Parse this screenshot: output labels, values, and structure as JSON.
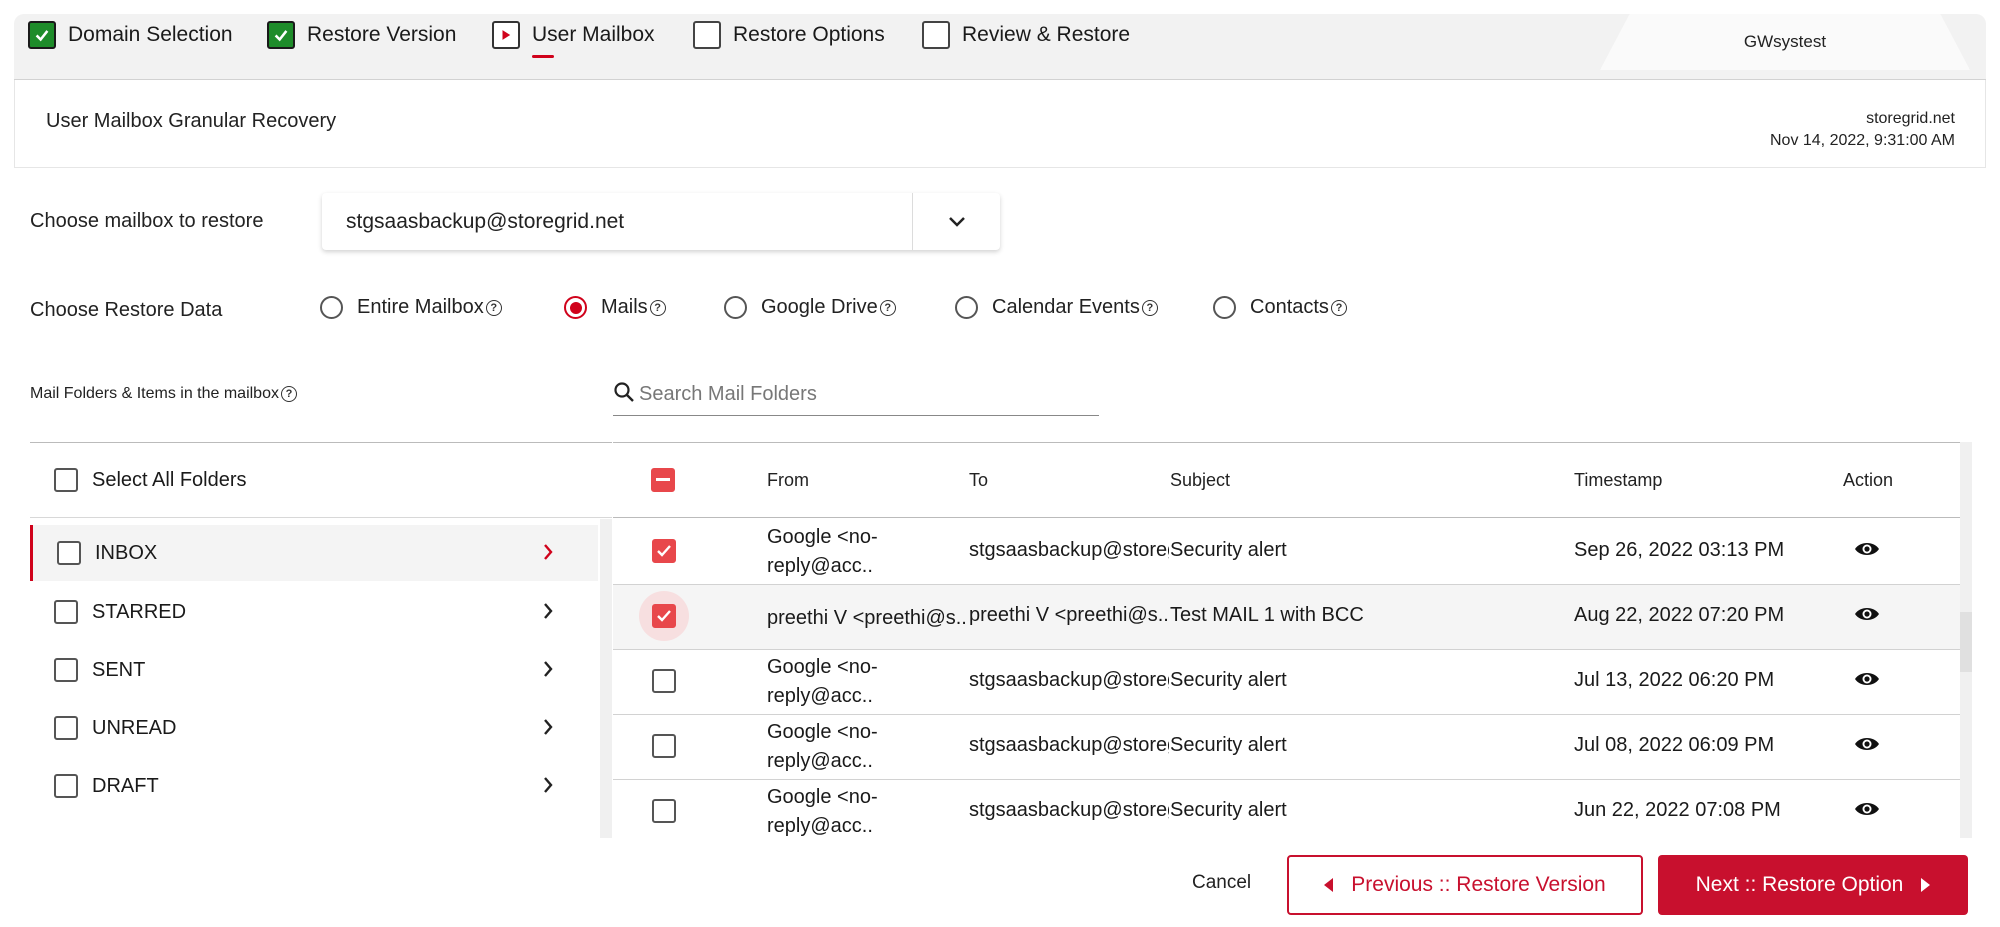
{
  "steps": [
    {
      "label": "Domain Selection",
      "state": "done"
    },
    {
      "label": "Restore Version",
      "state": "done"
    },
    {
      "label": "User Mailbox",
      "state": "current"
    },
    {
      "label": "Restore Options",
      "state": "pending"
    },
    {
      "label": "Review & Restore",
      "state": "pending"
    }
  ],
  "user_tab": "GWsystest",
  "header": {
    "title": "User Mailbox Granular Recovery",
    "domain": "storegrid.net",
    "version_time": "Nov 14, 2022, 9:31:00 AM"
  },
  "mailbox": {
    "label": "Choose mailbox to restore",
    "selected": "stgsaasbackup@storegrid.net"
  },
  "restore_data": {
    "label": "Choose Restore Data",
    "options": [
      "Entire Mailbox",
      "Mails",
      "Google Drive",
      "Calendar Events",
      "Contacts"
    ],
    "selected": "Mails"
  },
  "folders_caption": "Mail Folders & Items in the mailbox",
  "search": {
    "placeholder": "Search Mail Folders"
  },
  "folders": {
    "select_all": "Select All Folders",
    "items": [
      "INBOX",
      "STARRED",
      "SENT",
      "UNREAD",
      "DRAFT"
    ],
    "selected": "INBOX"
  },
  "table": {
    "columns": [
      "From",
      "To",
      "Subject",
      "Timestamp",
      "Action"
    ],
    "rows": [
      {
        "from": "Google <no-reply@acc..",
        "to": "stgsaasbackup@storeg",
        "subject": "Security alert",
        "timestamp": "Sep 26, 2022 03:13 PM",
        "checked": true
      },
      {
        "from": "preethi V <preethi@s..",
        "to": "preethi V <preethi@s..",
        "subject": "Test MAIL 1 with BCC",
        "timestamp": "Aug 22, 2022 07:20 PM",
        "checked": true
      },
      {
        "from": "Google <no-reply@acc..",
        "to": "stgsaasbackup@storeg",
        "subject": "Security alert",
        "timestamp": "Jul 13, 2022 06:20 PM",
        "checked": false
      },
      {
        "from": "Google <no-reply@acc..",
        "to": "stgsaasbackup@storeg",
        "subject": "Security alert",
        "timestamp": "Jul 08, 2022 06:09 PM",
        "checked": false
      },
      {
        "from": "Google <no-reply@acc..",
        "to": "stgsaasbackup@storeg",
        "subject": "Security alert",
        "timestamp": "Jun 22, 2022 07:08 PM",
        "checked": false
      }
    ]
  },
  "footer": {
    "cancel": "Cancel",
    "previous": "Previous :: Restore Version",
    "next": "Next :: Restore Option"
  },
  "colors": {
    "accent": "#c8102e",
    "done": "#1e8c2a",
    "checkbox": "#e8474b"
  }
}
